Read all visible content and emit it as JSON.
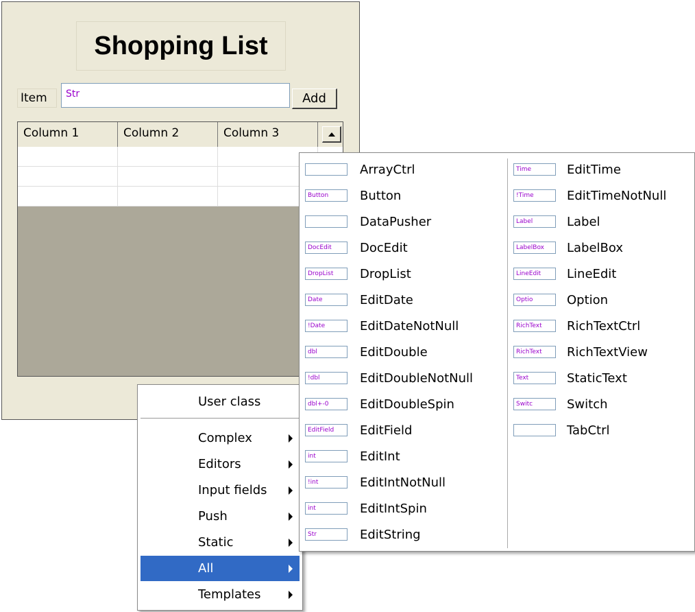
{
  "form": {
    "title": "Shopping List",
    "item_label": "Item",
    "item_input_value": "Str",
    "add_button": "Add",
    "grid": {
      "columns": [
        "Column 1",
        "Column 2",
        "Column 3"
      ],
      "rows": [
        [
          "",
          "",
          ""
        ],
        [
          "",
          "",
          ""
        ],
        [
          "",
          "",
          ""
        ]
      ]
    }
  },
  "context_menu": {
    "user_class": "User class",
    "items": [
      {
        "label": "Complex",
        "has_submenu": true
      },
      {
        "label": "Editors",
        "has_submenu": true
      },
      {
        "label": "Input fields",
        "has_submenu": true
      },
      {
        "label": "Push",
        "has_submenu": true
      },
      {
        "label": "Static",
        "has_submenu": true
      },
      {
        "label": "All",
        "has_submenu": true,
        "active": true
      },
      {
        "label": "Templates",
        "has_submenu": true
      }
    ]
  },
  "submenu": {
    "left": [
      {
        "label": "ArrayCtrl",
        "icon": "arrayctrl-icon",
        "icon_text": ""
      },
      {
        "label": "Button",
        "icon": "button-icon",
        "icon_text": "Button"
      },
      {
        "label": "DataPusher",
        "icon": "datapusher-icon",
        "icon_text": ""
      },
      {
        "label": "DocEdit",
        "icon": "docedit-icon",
        "icon_text": "DocEdit"
      },
      {
        "label": "DropList",
        "icon": "droplist-icon",
        "icon_text": "DropList"
      },
      {
        "label": "EditDate",
        "icon": "editdate-icon",
        "icon_text": "Date"
      },
      {
        "label": "EditDateNotNull",
        "icon": "editdatenotnull-icon",
        "icon_text": "!Date"
      },
      {
        "label": "EditDouble",
        "icon": "editdouble-icon",
        "icon_text": "dbl"
      },
      {
        "label": "EditDoubleNotNull",
        "icon": "editdoublenotnull-icon",
        "icon_text": "!dbl"
      },
      {
        "label": "EditDoubleSpin",
        "icon": "editdoublespin-icon",
        "icon_text": "dbl+-0"
      },
      {
        "label": "EditField",
        "icon": "editfield-icon",
        "icon_text": "EditField"
      },
      {
        "label": "EditInt",
        "icon": "editint-icon",
        "icon_text": "int"
      },
      {
        "label": "EditIntNotNull",
        "icon": "editintnotnull-icon",
        "icon_text": "!int"
      },
      {
        "label": "EditIntSpin",
        "icon": "editintspin-icon",
        "icon_text": "int"
      },
      {
        "label": "EditString",
        "icon": "editstring-icon",
        "icon_text": "Str"
      }
    ],
    "right": [
      {
        "label": "EditTime",
        "icon": "edittime-icon",
        "icon_text": "Time"
      },
      {
        "label": "EditTimeNotNull",
        "icon": "edittimenotnull-icon",
        "icon_text": "!Time"
      },
      {
        "label": "Label",
        "icon": "label-icon",
        "icon_text": "Label"
      },
      {
        "label": "LabelBox",
        "icon": "labelbox-icon",
        "icon_text": "LabelBox"
      },
      {
        "label": "LineEdit",
        "icon": "lineedit-icon",
        "icon_text": "LineEdit"
      },
      {
        "label": "Option",
        "icon": "option-icon",
        "icon_text": "Optio"
      },
      {
        "label": "RichTextCtrl",
        "icon": "richtextctrl-icon",
        "icon_text": "RichText"
      },
      {
        "label": "RichTextView",
        "icon": "richtextview-icon",
        "icon_text": "RichText"
      },
      {
        "label": "StaticText",
        "icon": "statictext-icon",
        "icon_text": "Text"
      },
      {
        "label": "Switch",
        "icon": "switch-icon",
        "icon_text": "Switc"
      },
      {
        "label": "TabCtrl",
        "icon": "tabctrl-icon",
        "icon_text": ""
      }
    ]
  },
  "colors": {
    "form_bg": "#ece9d8",
    "highlight": "#316ac5",
    "field_text": "#9900cc"
  }
}
